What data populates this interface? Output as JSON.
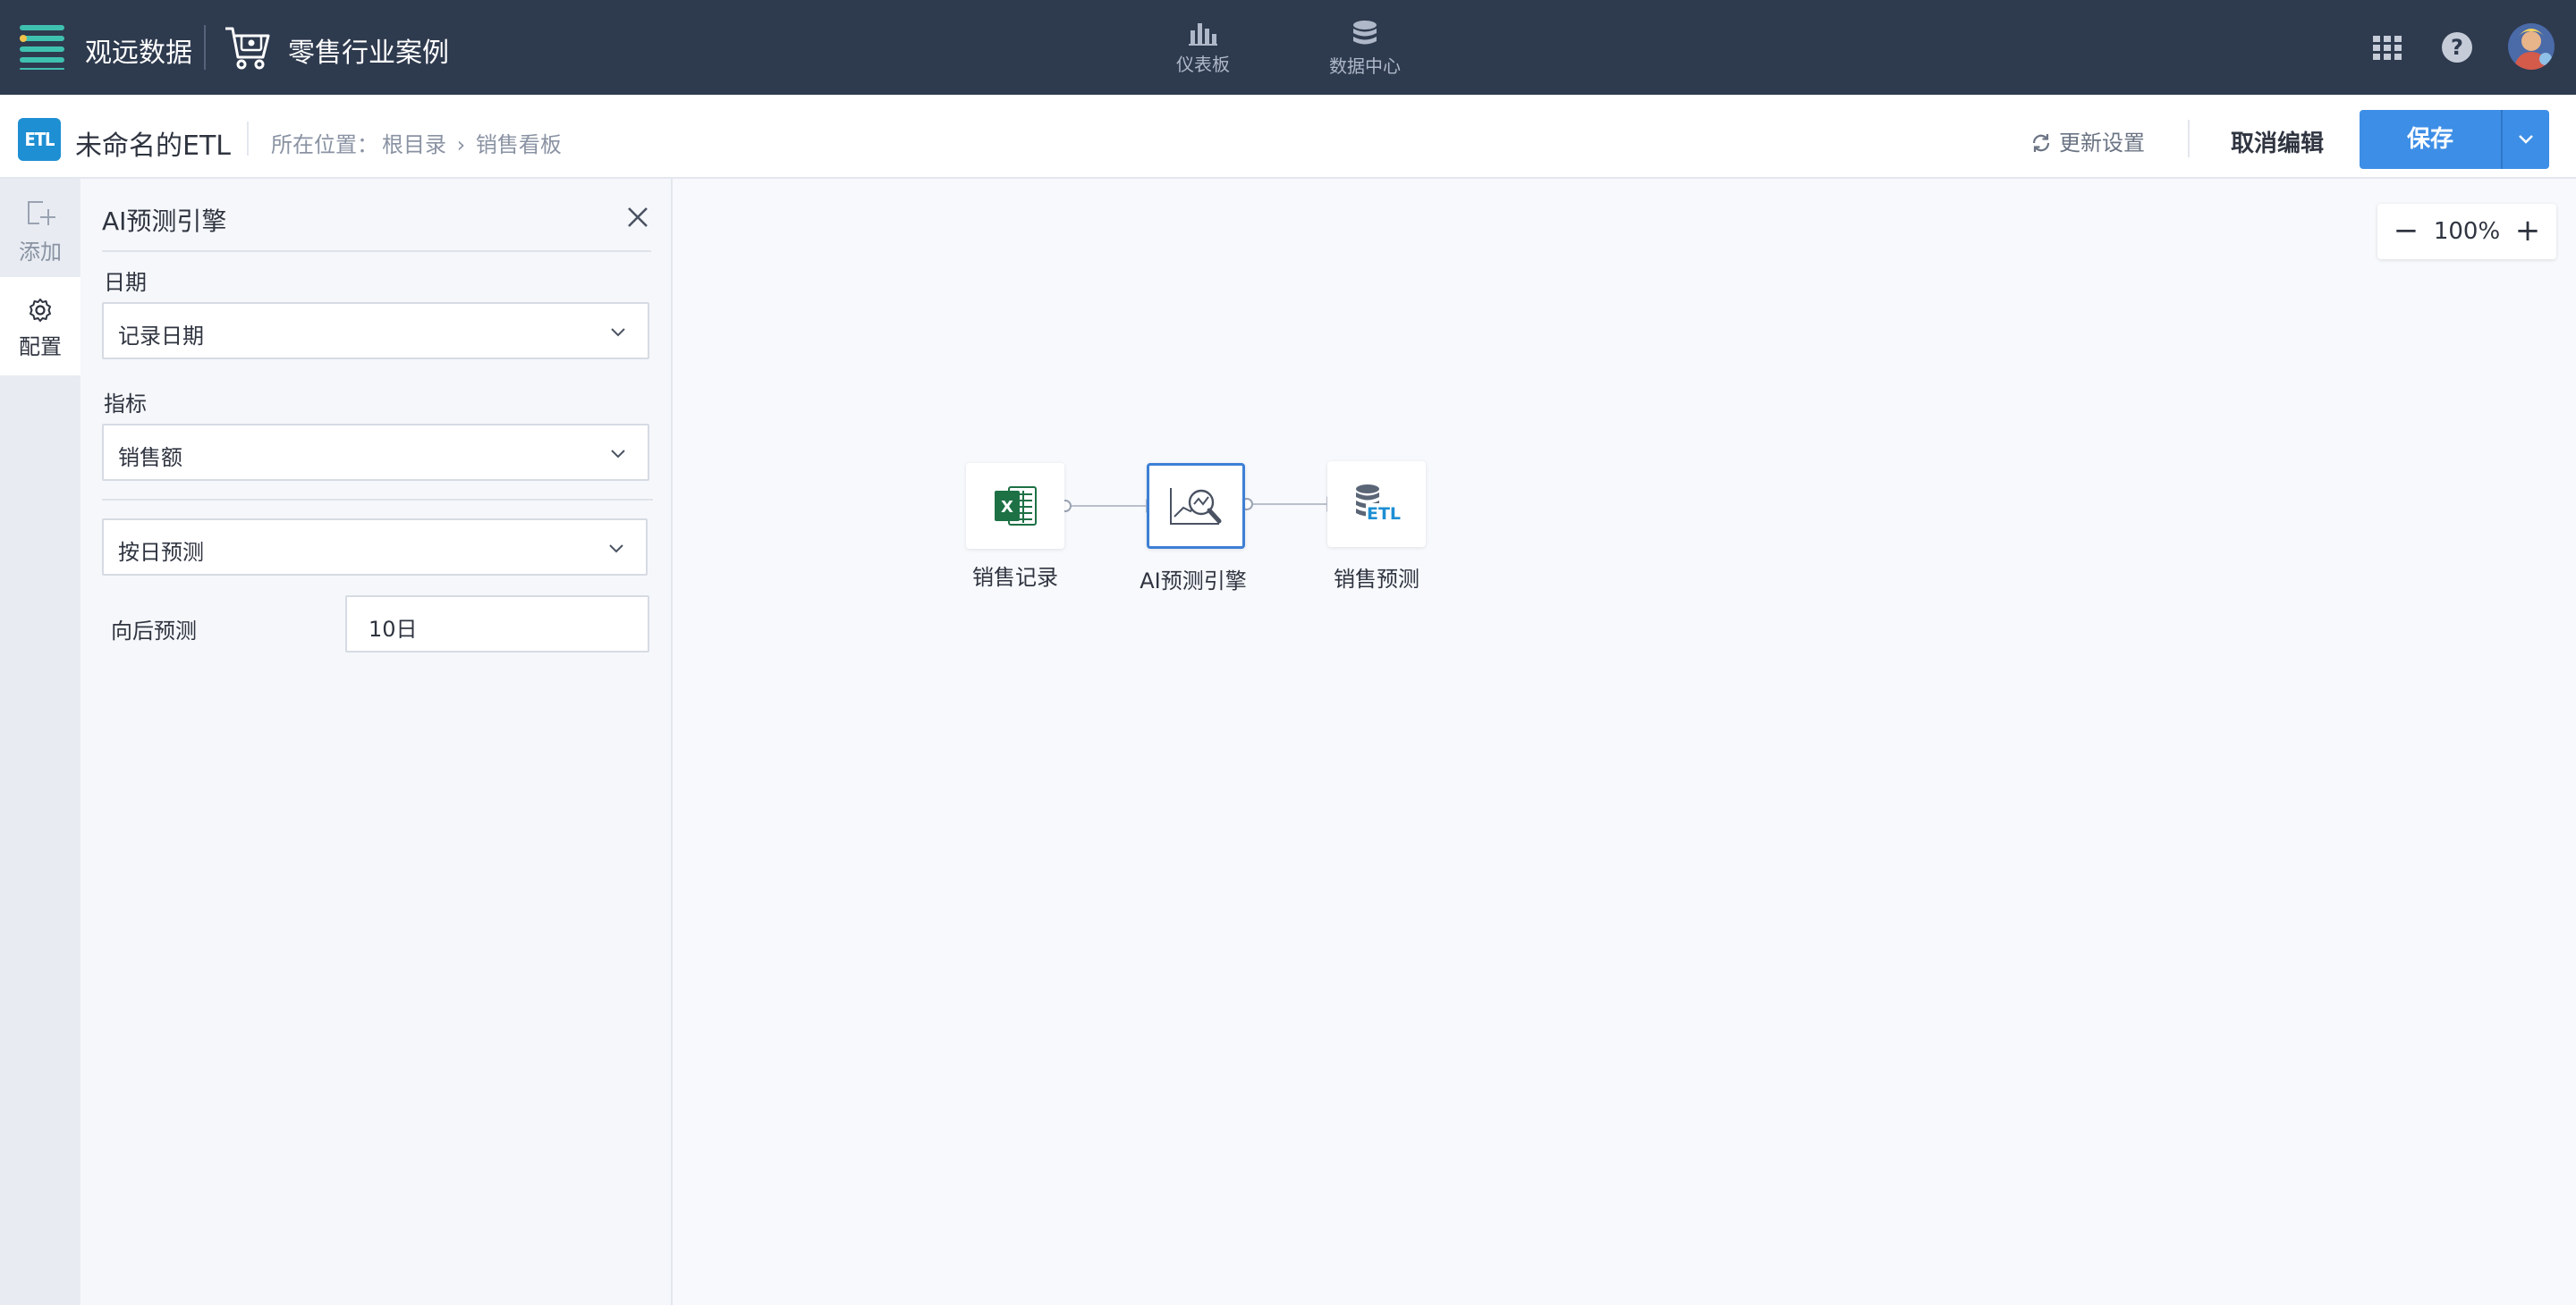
{
  "topbar": {
    "brand": "观远数据",
    "project": "零售行业案例",
    "nav": [
      {
        "label": "仪表板",
        "icon": "bar-chart-icon"
      },
      {
        "label": "数据中心",
        "icon": "database-icon"
      }
    ],
    "help_glyph": "?"
  },
  "subheader": {
    "badge": "ETL",
    "etl_name": "未命名的ETL",
    "breadcrumb": {
      "prefix": "所在位置：",
      "items": [
        "根目录",
        "销售看板"
      ],
      "separator": "›"
    },
    "refresh_label": "更新设置",
    "cancel_label": "取消编辑",
    "save_label": "保存"
  },
  "rail": {
    "add_label": "添加",
    "config_label": "配置"
  },
  "panel": {
    "title": "AI预测引擎",
    "date_label": "日期",
    "date_value": "记录日期",
    "metric_label": "指标",
    "metric_value": "销售额",
    "granularity_value": "按日预测",
    "forward_label": "向后预测",
    "forward_value": "10日"
  },
  "canvas": {
    "zoom_level": "100%",
    "zoom_minus": "−",
    "zoom_plus": "+",
    "nodes": [
      {
        "label": "销售记录",
        "icon": "excel-icon"
      },
      {
        "label": "AI预测引擎",
        "icon": "ai-forecast-icon"
      },
      {
        "label": "销售预测",
        "icon": "etl-output-icon"
      }
    ],
    "etl_text": "ETL",
    "excel_letter": "X"
  },
  "colors": {
    "topbar": "#2e3a4e",
    "accent": "#3d8ee6",
    "badge": "#1e8fd3",
    "menu_teal": "#3fc1b0"
  }
}
